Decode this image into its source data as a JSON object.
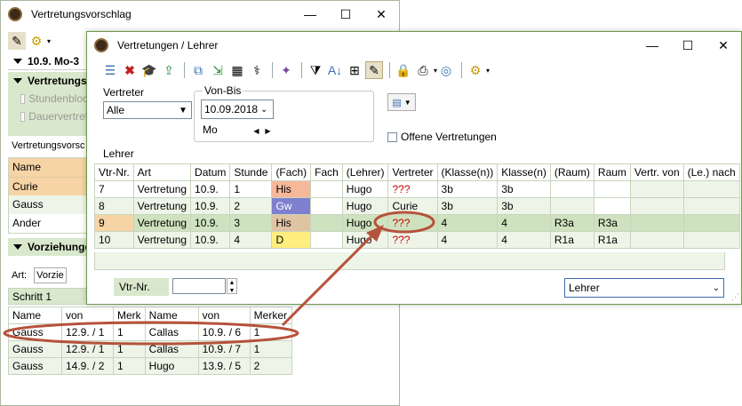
{
  "back_window": {
    "title": "Vertretungsvorschlag",
    "controls": {
      "min": "—",
      "max": "☐",
      "close": "✕"
    },
    "header_row": "10.9. Mo-3",
    "section1": "Vertretungs",
    "checkbox1": "Stundenbloc",
    "checkbox2": "Dauervertret",
    "tab_label": "Vertretungsvorsc",
    "name_list": [
      "Name",
      "Curie",
      "Gauss",
      "Ander"
    ],
    "section2": "Vorziehunge",
    "art_label": "Art:",
    "art_value": "Vorzie",
    "step_label": "Schritt 1",
    "bottom_table": {
      "headers": [
        "Name",
        "von",
        "Merk",
        "Name",
        "von",
        "Merker"
      ],
      "rows": [
        [
          "Gauss",
          "12.9. / 1",
          "1",
          "Callas",
          "10.9. / 6",
          "1"
        ],
        [
          "Gauss",
          "12.9. / 1",
          "1",
          "Callas",
          "10.9. / 7",
          "1"
        ],
        [
          "Gauss",
          "14.9. / 2",
          "1",
          "Hugo",
          "13.9. / 5",
          "2"
        ]
      ]
    }
  },
  "front_window": {
    "title": "Vertretungen / Lehrer",
    "controls": {
      "min": "—",
      "max": "☐",
      "close": "✕"
    },
    "vertreter_label": "Vertreter",
    "vertreter_value": "Alle",
    "vonbis_label": "Von-Bis",
    "date_value": "10.09.2018",
    "day_label": "Mo",
    "offene_label": "Offene Vertretungen",
    "lehrer_label": "Lehrer",
    "table": {
      "headers": [
        "Vtr-Nr.",
        "Art",
        "Datum",
        "Stunde",
        "(Fach)",
        "Fach",
        "(Lehrer)",
        "Vertreter",
        "(Klasse(n))",
        "Klasse(n)",
        "(Raum)",
        "Raum",
        "Vertr. von",
        "(Le.) nach"
      ],
      "rows": [
        [
          "7",
          "Vertretung",
          "10.9.",
          "1",
          "His",
          "",
          "Hugo",
          "???",
          "3b",
          "3b",
          "",
          "",
          "",
          ""
        ],
        [
          "8",
          "Vertretung",
          "10.9.",
          "2",
          "Gw",
          "",
          "Hugo",
          "Curie",
          "3b",
          "3b",
          "",
          "",
          "",
          ""
        ],
        [
          "9",
          "Vertretung",
          "10.9.",
          "3",
          "His",
          "",
          "Hugo",
          "???",
          "4",
          "4",
          "R3a",
          "R3a",
          "",
          ""
        ],
        [
          "10",
          "Vertretung",
          "10.9.",
          "4",
          "D",
          "",
          "Hugo",
          "???",
          "4",
          "4",
          "R1a",
          "R1a",
          "",
          ""
        ]
      ]
    },
    "vtr_label": "Vtr-Nr.",
    "vtr_value": "",
    "select_value": "Lehrer"
  },
  "colors": {
    "accent_green": "#d9e8cc",
    "annotation": "#b5523b",
    "his": "#f7b89a",
    "gw": "#7f7fcf",
    "d": "#ffef7f",
    "row9": "#cfe2bf",
    "row9_cell": "#f6d4a6"
  }
}
